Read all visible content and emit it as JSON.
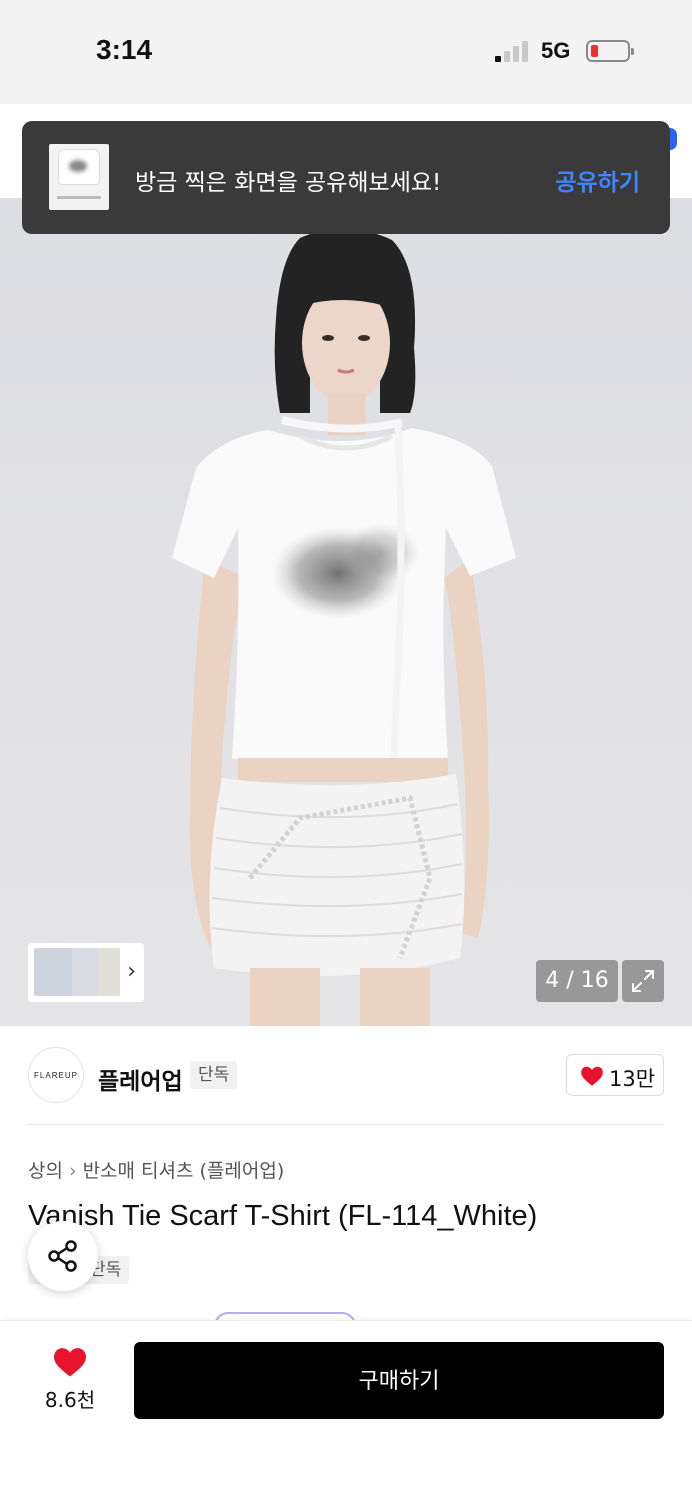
{
  "status_bar": {
    "time": "3:14",
    "network": "5G",
    "battery_level": 0.12,
    "battery_color": "#e8322c"
  },
  "toast": {
    "message": "방금 찍은 화면을 공유해보세요!",
    "action_label": "공유하기",
    "action_color": "#3d86ff"
  },
  "gallery": {
    "counter": "4 / 16",
    "thumb_chevron": "›",
    "expand_icon": "expand-icon"
  },
  "brand": {
    "logo_text": "FLAREUP",
    "name": "플레어업",
    "badge": "단독",
    "like_count": "13만"
  },
  "product": {
    "breadcrumb": [
      "상의",
      "반소매 티셔츠 (플레어업)"
    ],
    "breadcrumb_sep": "›",
    "title": "Vanish Tie Scarf T-Shirt (FL-114_White)",
    "badge": "단독"
  },
  "bottom_bar": {
    "wish_count": "8.6천",
    "buy_label": "구매하기",
    "heart_color": "#e8142d"
  }
}
